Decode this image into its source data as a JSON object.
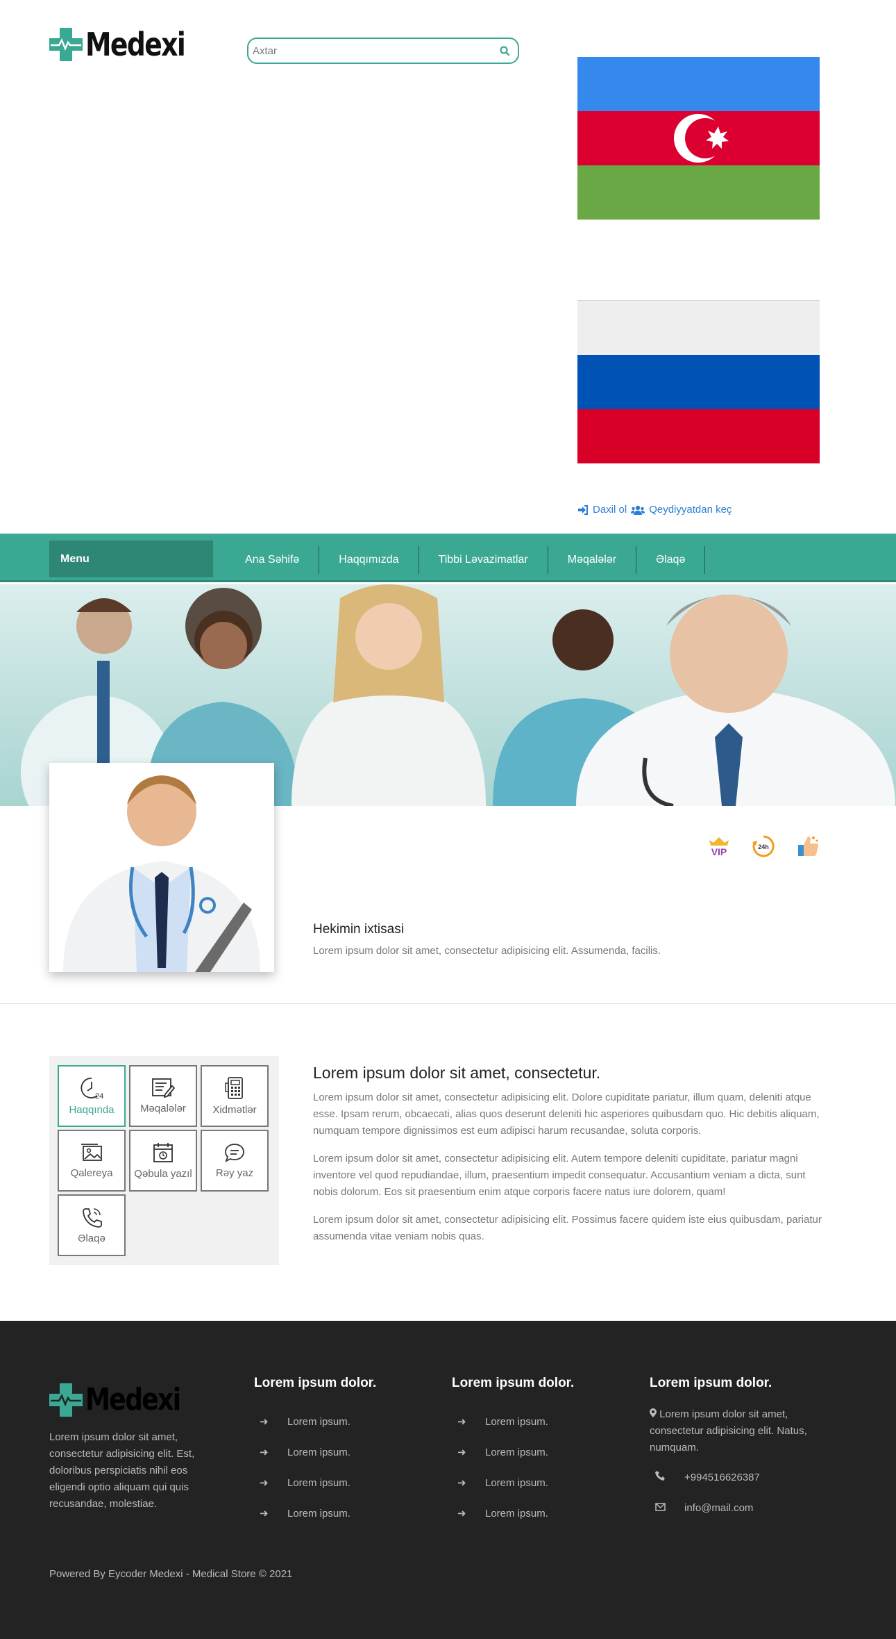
{
  "header": {
    "brand": "Medexi",
    "search": {
      "placeholder": "Axtar"
    }
  },
  "auth": {
    "login": "Daxil ol",
    "register": "Qeydiyyatdan keç"
  },
  "nav": {
    "menu_label": "Menu",
    "items": [
      "Ana Səhifə",
      "Haqqımızda",
      "Tibbi Ləvazimatlar",
      "Məqalələr",
      "Əlaqə"
    ]
  },
  "profile": {
    "badges": [
      "VIP",
      "24h"
    ],
    "specialty_title": "Hekimin ixtisasi",
    "specialty_text": "Lorem ipsum dolor sit amet, consectetur adipisicing elit. Assumenda, facilis."
  },
  "tiles": [
    {
      "label": "Haqqında",
      "icon": "clock-24-icon"
    },
    {
      "label": "Məqalələr",
      "icon": "article-edit-icon"
    },
    {
      "label": "Xidmətlər",
      "icon": "calculator-icon"
    },
    {
      "label": "Qalereya",
      "icon": "gallery-icon"
    },
    {
      "label": "Qəbula yazıl",
      "icon": "calendar-icon"
    },
    {
      "label": "Rəy yaz",
      "icon": "chat-icon"
    },
    {
      "label": "Əlaqə",
      "icon": "phone-icon"
    }
  ],
  "about": {
    "title": "Lorem ipsum dolor sit amet, consectetur.",
    "paragraphs": [
      "Lorem ipsum dolor sit amet, consectetur adipisicing elit. Dolore cupiditate pariatur, illum quam, deleniti atque esse. Ipsam rerum, obcaecati, alias quos deserunt deleniti hic asperiores quibusdam quo. Hic debitis aliquam, numquam tempore dignissimos est eum adipisci harum recusandae, soluta corporis.",
      "Lorem ipsum dolor sit amet, consectetur adipisicing elit. Autem tempore deleniti cupiditate, pariatur magni inventore vel quod repudiandae, illum, praesentium impedit consequatur. Accusantium veniam a dicta, sunt nobis dolorum. Eos sit praesentium enim atque corporis facere natus iure dolorem, quam!",
      "Lorem ipsum dolor sit amet, consectetur adipisicing elit. Possimus facere quidem iste eius quibusdam, pariatur assumenda vitae veniam nobis quas."
    ]
  },
  "footer": {
    "brand": "Medexi",
    "description": "Lorem ipsum dolor sit amet, consectetur adipisicing elit. Est, doloribus perspiciatis nihil eos eligendi optio aliquam qui quis recusandae, molestiae.",
    "col1": {
      "title": "Lorem ipsum dolor.",
      "links": [
        "Lorem ipsum.",
        "Lorem ipsum.",
        "Lorem ipsum.",
        "Lorem ipsum."
      ]
    },
    "col2": {
      "title": "Lorem ipsum dolor.",
      "links": [
        "Lorem ipsum.",
        "Lorem ipsum.",
        "Lorem ipsum.",
        "Lorem ipsum."
      ]
    },
    "col3": {
      "title": "Lorem ipsum dolor.",
      "address": "Lorem ipsum dolor sit amet, consectetur adipisicing elit. Natus, numquam.",
      "phone": "+994516626387",
      "email": "info@mail.com"
    },
    "copyright": "Powered By Eycoder Medexi - Medical Store © 2021"
  },
  "colors": {
    "accent": "#3aa893",
    "accent_dark": "#2e8674",
    "footer_bg": "#232323",
    "link": "#2a7fd4"
  }
}
